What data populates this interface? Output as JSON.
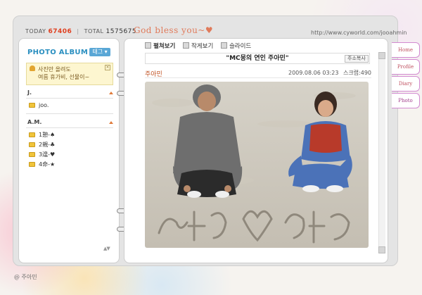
{
  "header": {
    "today_label": "TODAY",
    "today_count": "67406",
    "total_label": "TOTAL",
    "total_count": "1575675",
    "tagline": "God bless you~♥",
    "url": "http://www.cyworld.com/jooahmin"
  },
  "sidebar": {
    "title": "PHOTO ALBUM",
    "tag_button": "태그",
    "notice_line1": "사진만 올려도",
    "notice_line2": "여름 휴가비, 선물이~",
    "groups": [
      {
        "title": "J.",
        "folders": [
          "joo."
        ]
      },
      {
        "title": "A.M.",
        "folders": [
          "1憩-♠",
          "2親-♣",
          "3遑-♥",
          "4命-★"
        ]
      }
    ]
  },
  "content": {
    "view_options": [
      "펼쳐보기",
      "작게보기",
      "슬라이드"
    ],
    "post_title": "\"MC몽의 연인 주아민\"",
    "address_button": "주소복사",
    "author": "주아민",
    "date": "2009.08.06 03:23",
    "scrap_label": "스크랩",
    "scrap_count": "490"
  },
  "tabs": [
    "Home",
    "Profile",
    "Diary",
    "Photo"
  ],
  "signature": "@ 주아민",
  "colors": {
    "accent_blue": "#2a8fc0",
    "counter_red": "#e04020",
    "tab_border": "#d28ad0"
  }
}
